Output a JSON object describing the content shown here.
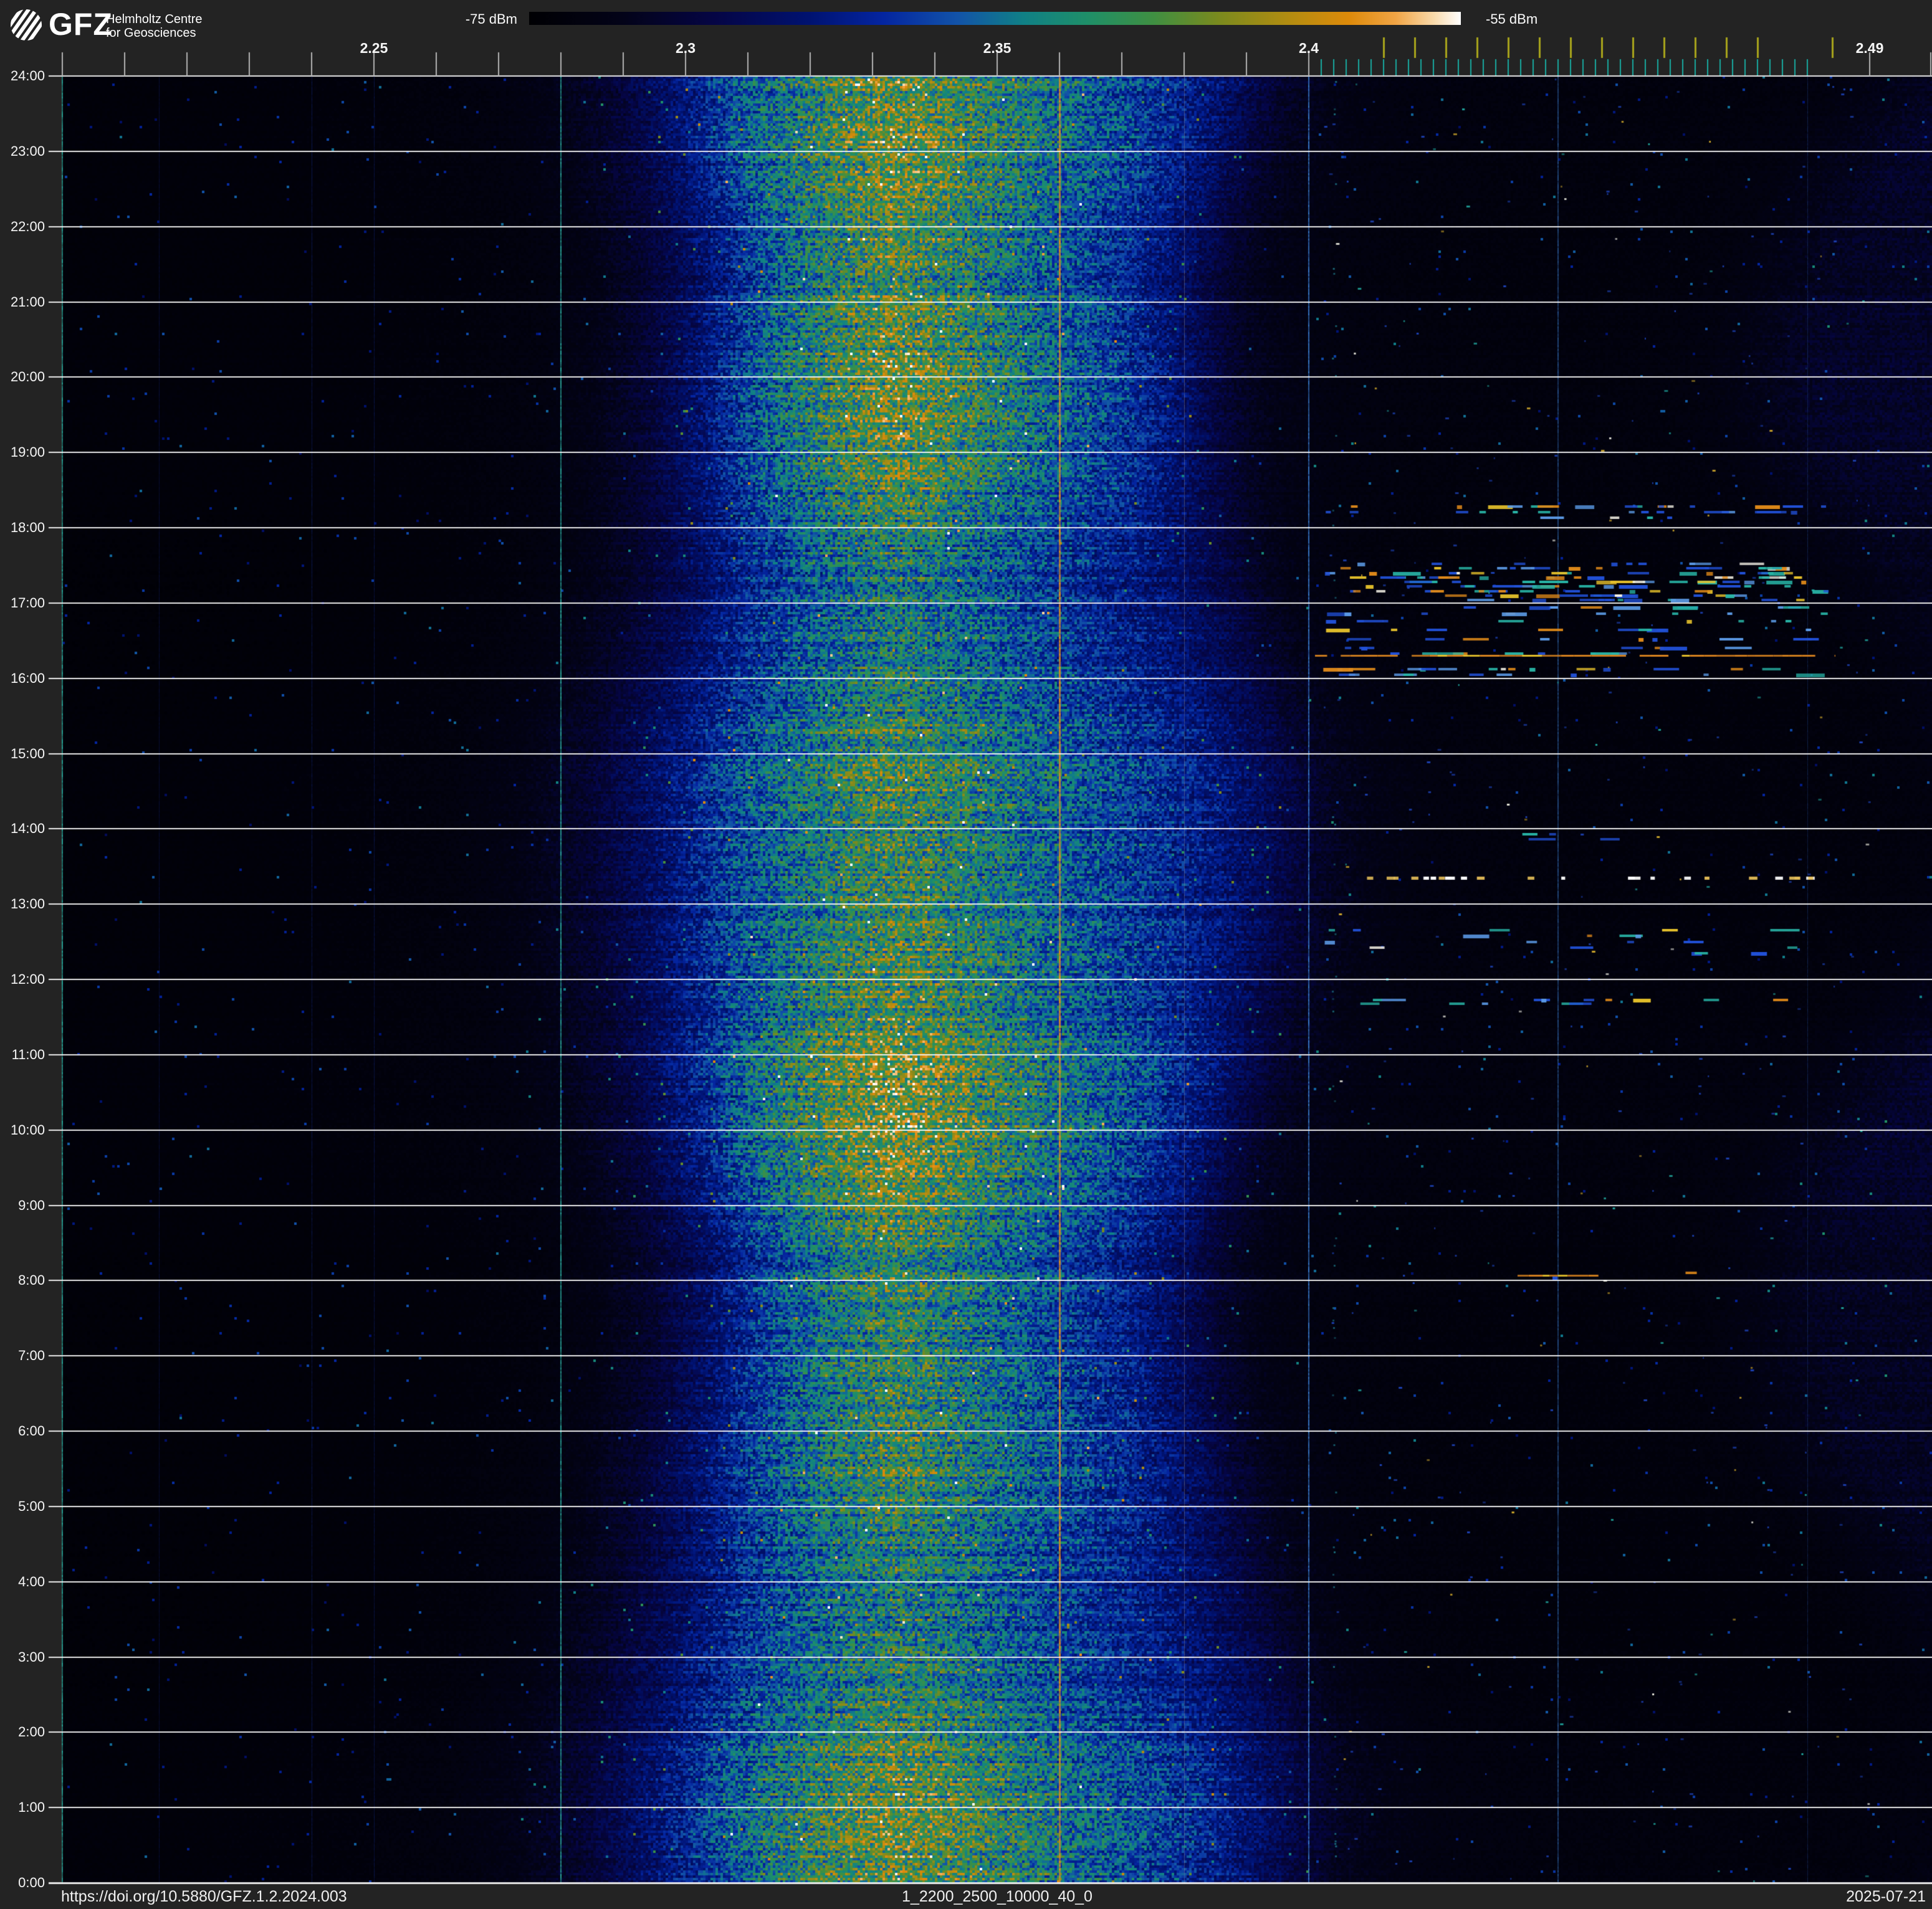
{
  "header": {
    "logo": {
      "acronym": "GFZ",
      "tagline_line1": "Helmholtz Centre",
      "tagline_line2": "for Geosciences"
    },
    "colorbar": {
      "min_label": "-75 dBm",
      "max_label": "-55 dBm"
    }
  },
  "footer": {
    "doi": "https://doi.org/10.5880/GFZ.1.2.2024.003",
    "dataset_id": "1_2200_2500_10000_40_0",
    "date": "2025-07-21"
  },
  "chart_data": {
    "type": "heatmap",
    "subtype": "24h-radio-spectrogram-waterfall",
    "power_scale_dbm": {
      "min": -75,
      "max": -55
    },
    "x_axis": {
      "unit": "GHz",
      "min": 2.2,
      "max": 2.5,
      "labeled_ticks": [
        "2.25",
        "2.3",
        "2.35",
        "2.4",
        "2.49"
      ],
      "labeled_tick_values": [
        2.25,
        2.3,
        2.35,
        2.4,
        2.49
      ],
      "minor_tick_start": 2.2,
      "minor_tick_end": 2.4,
      "minor_tick_step": 0.01,
      "extra_ticks": [
        2.49,
        2.5
      ],
      "wifi_channel_ticks_ghz": [
        2.412,
        2.417,
        2.422,
        2.427,
        2.432,
        2.437,
        2.442,
        2.447,
        2.452,
        2.457,
        2.462,
        2.467,
        2.472,
        2.484
      ],
      "ble_channel_ticks_ghz": {
        "start": 2.402,
        "step": 0.002,
        "count": 40
      },
      "tick_colors": {
        "minor": "#b2b2b2",
        "wifi": "#a8a41c",
        "ble": "#18a79e"
      }
    },
    "y_axis": {
      "unit": "time of day",
      "hour_labels": [
        "24:00",
        "23:00",
        "22:00",
        "21:00",
        "20:00",
        "19:00",
        "18:00",
        "17:00",
        "16:00",
        "15:00",
        "14:00",
        "13:00",
        "12:00",
        "11:00",
        "10:00",
        "9:00",
        "8:00",
        "7:00",
        "6:00",
        "5:00",
        "4:00",
        "3:00",
        "2:00",
        "1:00",
        "0:00"
      ]
    },
    "colormap_stops": [
      [
        0.0,
        "#000003"
      ],
      [
        0.1,
        "#030318"
      ],
      [
        0.2,
        "#050545"
      ],
      [
        0.3,
        "#001270"
      ],
      [
        0.38,
        "#0425a0"
      ],
      [
        0.46,
        "#1253a8"
      ],
      [
        0.53,
        "#108086"
      ],
      [
        0.6,
        "#1f8f68"
      ],
      [
        0.67,
        "#3f8f42"
      ],
      [
        0.74,
        "#7a8a1e"
      ],
      [
        0.82,
        "#b68c10"
      ],
      [
        0.88,
        "#dd8a0a"
      ],
      [
        0.93,
        "#f0a445"
      ],
      [
        0.97,
        "#f8d8a8"
      ],
      [
        1.0,
        "#ffffff"
      ]
    ],
    "broadband_emission": {
      "center_ghz": 2.333,
      "extent_ghz": [
        2.28,
        2.4
      ],
      "envelope_points": [
        [
          2.2,
          0.03
        ],
        [
          2.23,
          0.032
        ],
        [
          2.255,
          0.04
        ],
        [
          2.27,
          0.055
        ],
        [
          2.28,
          0.085
        ],
        [
          2.29,
          0.155
        ],
        [
          2.3,
          0.28
        ],
        [
          2.31,
          0.43
        ],
        [
          2.318,
          0.52
        ],
        [
          2.325,
          0.59
        ],
        [
          2.333,
          0.65
        ],
        [
          2.34,
          0.615
        ],
        [
          2.348,
          0.555
        ],
        [
          2.355,
          0.505
        ],
        [
          2.36,
          0.465
        ],
        [
          2.368,
          0.41
        ],
        [
          2.375,
          0.36
        ],
        [
          2.38,
          0.31
        ],
        [
          2.386,
          0.245
        ],
        [
          2.392,
          0.16
        ],
        [
          2.397,
          0.11
        ],
        [
          2.402,
          0.085
        ],
        [
          2.41,
          0.062
        ],
        [
          2.425,
          0.05
        ],
        [
          2.45,
          0.045
        ],
        [
          2.47,
          0.048
        ],
        [
          2.48,
          0.058
        ],
        [
          2.488,
          0.085
        ],
        [
          2.5,
          0.125
        ]
      ]
    },
    "carriers": [
      {
        "freq_ghz": 2.2,
        "color": "#2aa79b",
        "width": 2,
        "alpha": 0.9
      },
      {
        "freq_ghz": 2.2155,
        "color": "#10206a",
        "width": 1,
        "alpha": 0.5
      },
      {
        "freq_ghz": 2.24,
        "color": "#122a86",
        "width": 1,
        "alpha": 0.55
      },
      {
        "freq_ghz": 2.25,
        "color": "#122a86",
        "width": 1,
        "alpha": 0.5
      },
      {
        "freq_ghz": 2.28,
        "color": "#2aa79b",
        "width": 2,
        "alpha": 0.95
      },
      {
        "freq_ghz": 2.36,
        "color": "#d98a25",
        "width": 3,
        "alpha": 1.0
      },
      {
        "freq_ghz": 2.38,
        "color": "#9a9a9a",
        "width": 1,
        "alpha": 0.48
      },
      {
        "freq_ghz": 2.4,
        "color": "#3b7fd4",
        "width": 2,
        "alpha": 0.9
      },
      {
        "freq_ghz": 2.44,
        "color": "#3b7fd4",
        "width": 2,
        "alpha": 0.55
      },
      {
        "freq_ghz": 2.48,
        "color": "#2a5ab0",
        "width": 1,
        "alpha": 0.4
      }
    ],
    "activity": {
      "band_ghz": [
        2.402,
        2.484
      ],
      "palettes": {
        "hot": [
          [
            "#e08a1a",
            0.26
          ],
          [
            "#e8c32c",
            0.14
          ],
          [
            "#f5f2e6",
            0.12
          ],
          [
            "#28b4a6",
            0.16
          ],
          [
            "#2150d6",
            0.22
          ],
          [
            "#5b9ae6",
            0.1
          ]
        ],
        "mixed": [
          [
            "#e08a1a",
            0.16
          ],
          [
            "#e8c32c",
            0.08
          ],
          [
            "#f5f2e6",
            0.05
          ],
          [
            "#28b4a6",
            0.22
          ],
          [
            "#2150d6",
            0.34
          ],
          [
            "#5b9ae6",
            0.15
          ]
        ],
        "cool": [
          [
            "#2150d6",
            0.45
          ],
          [
            "#5b9ae6",
            0.2
          ],
          [
            "#28b4a6",
            0.2
          ],
          [
            "#e08a1a",
            0.08
          ],
          [
            "#f5f2e6",
            0.07
          ]
        ]
      },
      "rows": [
        {
          "time": 18.28,
          "density": 0.5,
          "palette": "hot"
        },
        {
          "time": 18.21,
          "density": 0.45,
          "palette": "cool"
        },
        {
          "time": 18.13,
          "density": 0.12,
          "palette": "cool"
        },
        {
          "time": 17.52,
          "density": 0.28,
          "palette": "cool"
        },
        {
          "time": 17.46,
          "density": 0.5,
          "palette": "hot"
        },
        {
          "time": 17.4,
          "density": 0.55,
          "palette": "hot"
        },
        {
          "time": 17.34,
          "density": 0.6,
          "palette": "hot"
        },
        {
          "time": 17.28,
          "density": 0.5,
          "palette": "mixed"
        },
        {
          "time": 17.22,
          "density": 0.5,
          "palette": "mixed"
        },
        {
          "time": 17.16,
          "density": 0.55,
          "palette": "hot"
        },
        {
          "time": 17.1,
          "density": 0.45,
          "palette": "mixed"
        },
        {
          "time": 17.04,
          "density": 0.35,
          "palette": "mixed"
        },
        {
          "time": 16.94,
          "density": 0.32,
          "palette": "cool"
        },
        {
          "time": 16.86,
          "density": 0.3,
          "palette": "mixed"
        },
        {
          "time": 16.76,
          "density": 0.3,
          "palette": "mixed"
        },
        {
          "time": 16.64,
          "density": 0.33,
          "palette": "mixed"
        },
        {
          "time": 16.52,
          "density": 0.28,
          "palette": "cool"
        },
        {
          "time": 16.4,
          "density": 0.22,
          "palette": "cool"
        },
        {
          "time": 16.33,
          "density": 0.3,
          "palette": "mixed"
        },
        {
          "time": 16.12,
          "density": 0.5,
          "palette": "mixed"
        },
        {
          "time": 16.05,
          "density": 0.28,
          "palette": "cool"
        },
        {
          "time": 13.93,
          "density": 0.07,
          "palette": "cool"
        },
        {
          "time": 13.86,
          "density": 0.05,
          "palette": "cool"
        },
        {
          "time": 12.65,
          "density": 0.15,
          "palette": "mixed"
        },
        {
          "time": 12.58,
          "density": 0.14,
          "palette": "mixed"
        },
        {
          "time": 12.5,
          "density": 0.12,
          "palette": "cool"
        },
        {
          "time": 12.42,
          "density": 0.1,
          "palette": "cool"
        },
        {
          "time": 12.35,
          "density": 0.08,
          "palette": "cool"
        },
        {
          "time": 11.73,
          "density": 0.28,
          "palette": "mixed"
        },
        {
          "time": 11.68,
          "density": 0.15,
          "palette": "cool"
        },
        {
          "time": 8.1,
          "density": 0.22,
          "palette": "hot",
          "f_start": 2.447,
          "f_end": 2.463
        },
        {
          "time": 8.04,
          "density": 0.12,
          "palette": "cool",
          "f_start": 2.43,
          "f_end": 2.462
        }
      ],
      "streaks": [
        {
          "time": 16.3,
          "f_start": 2.401,
          "f_end": 2.4845,
          "color": "#d9831f",
          "alt_color": "#e8c32c"
        },
        {
          "time": 8.07,
          "f_start": 2.4335,
          "f_end": 2.4465,
          "color": "#d9831f",
          "alt_color": "#e8c32c"
        }
      ],
      "dot_rows": [
        {
          "time": 13.35,
          "count": 26,
          "colors": [
            "#ffffff",
            "#e8c05a"
          ]
        }
      ],
      "beacon_column_ghz": 2.404,
      "sparse_speck_row_chance": 0.5
    },
    "noise_seed": 7
  }
}
